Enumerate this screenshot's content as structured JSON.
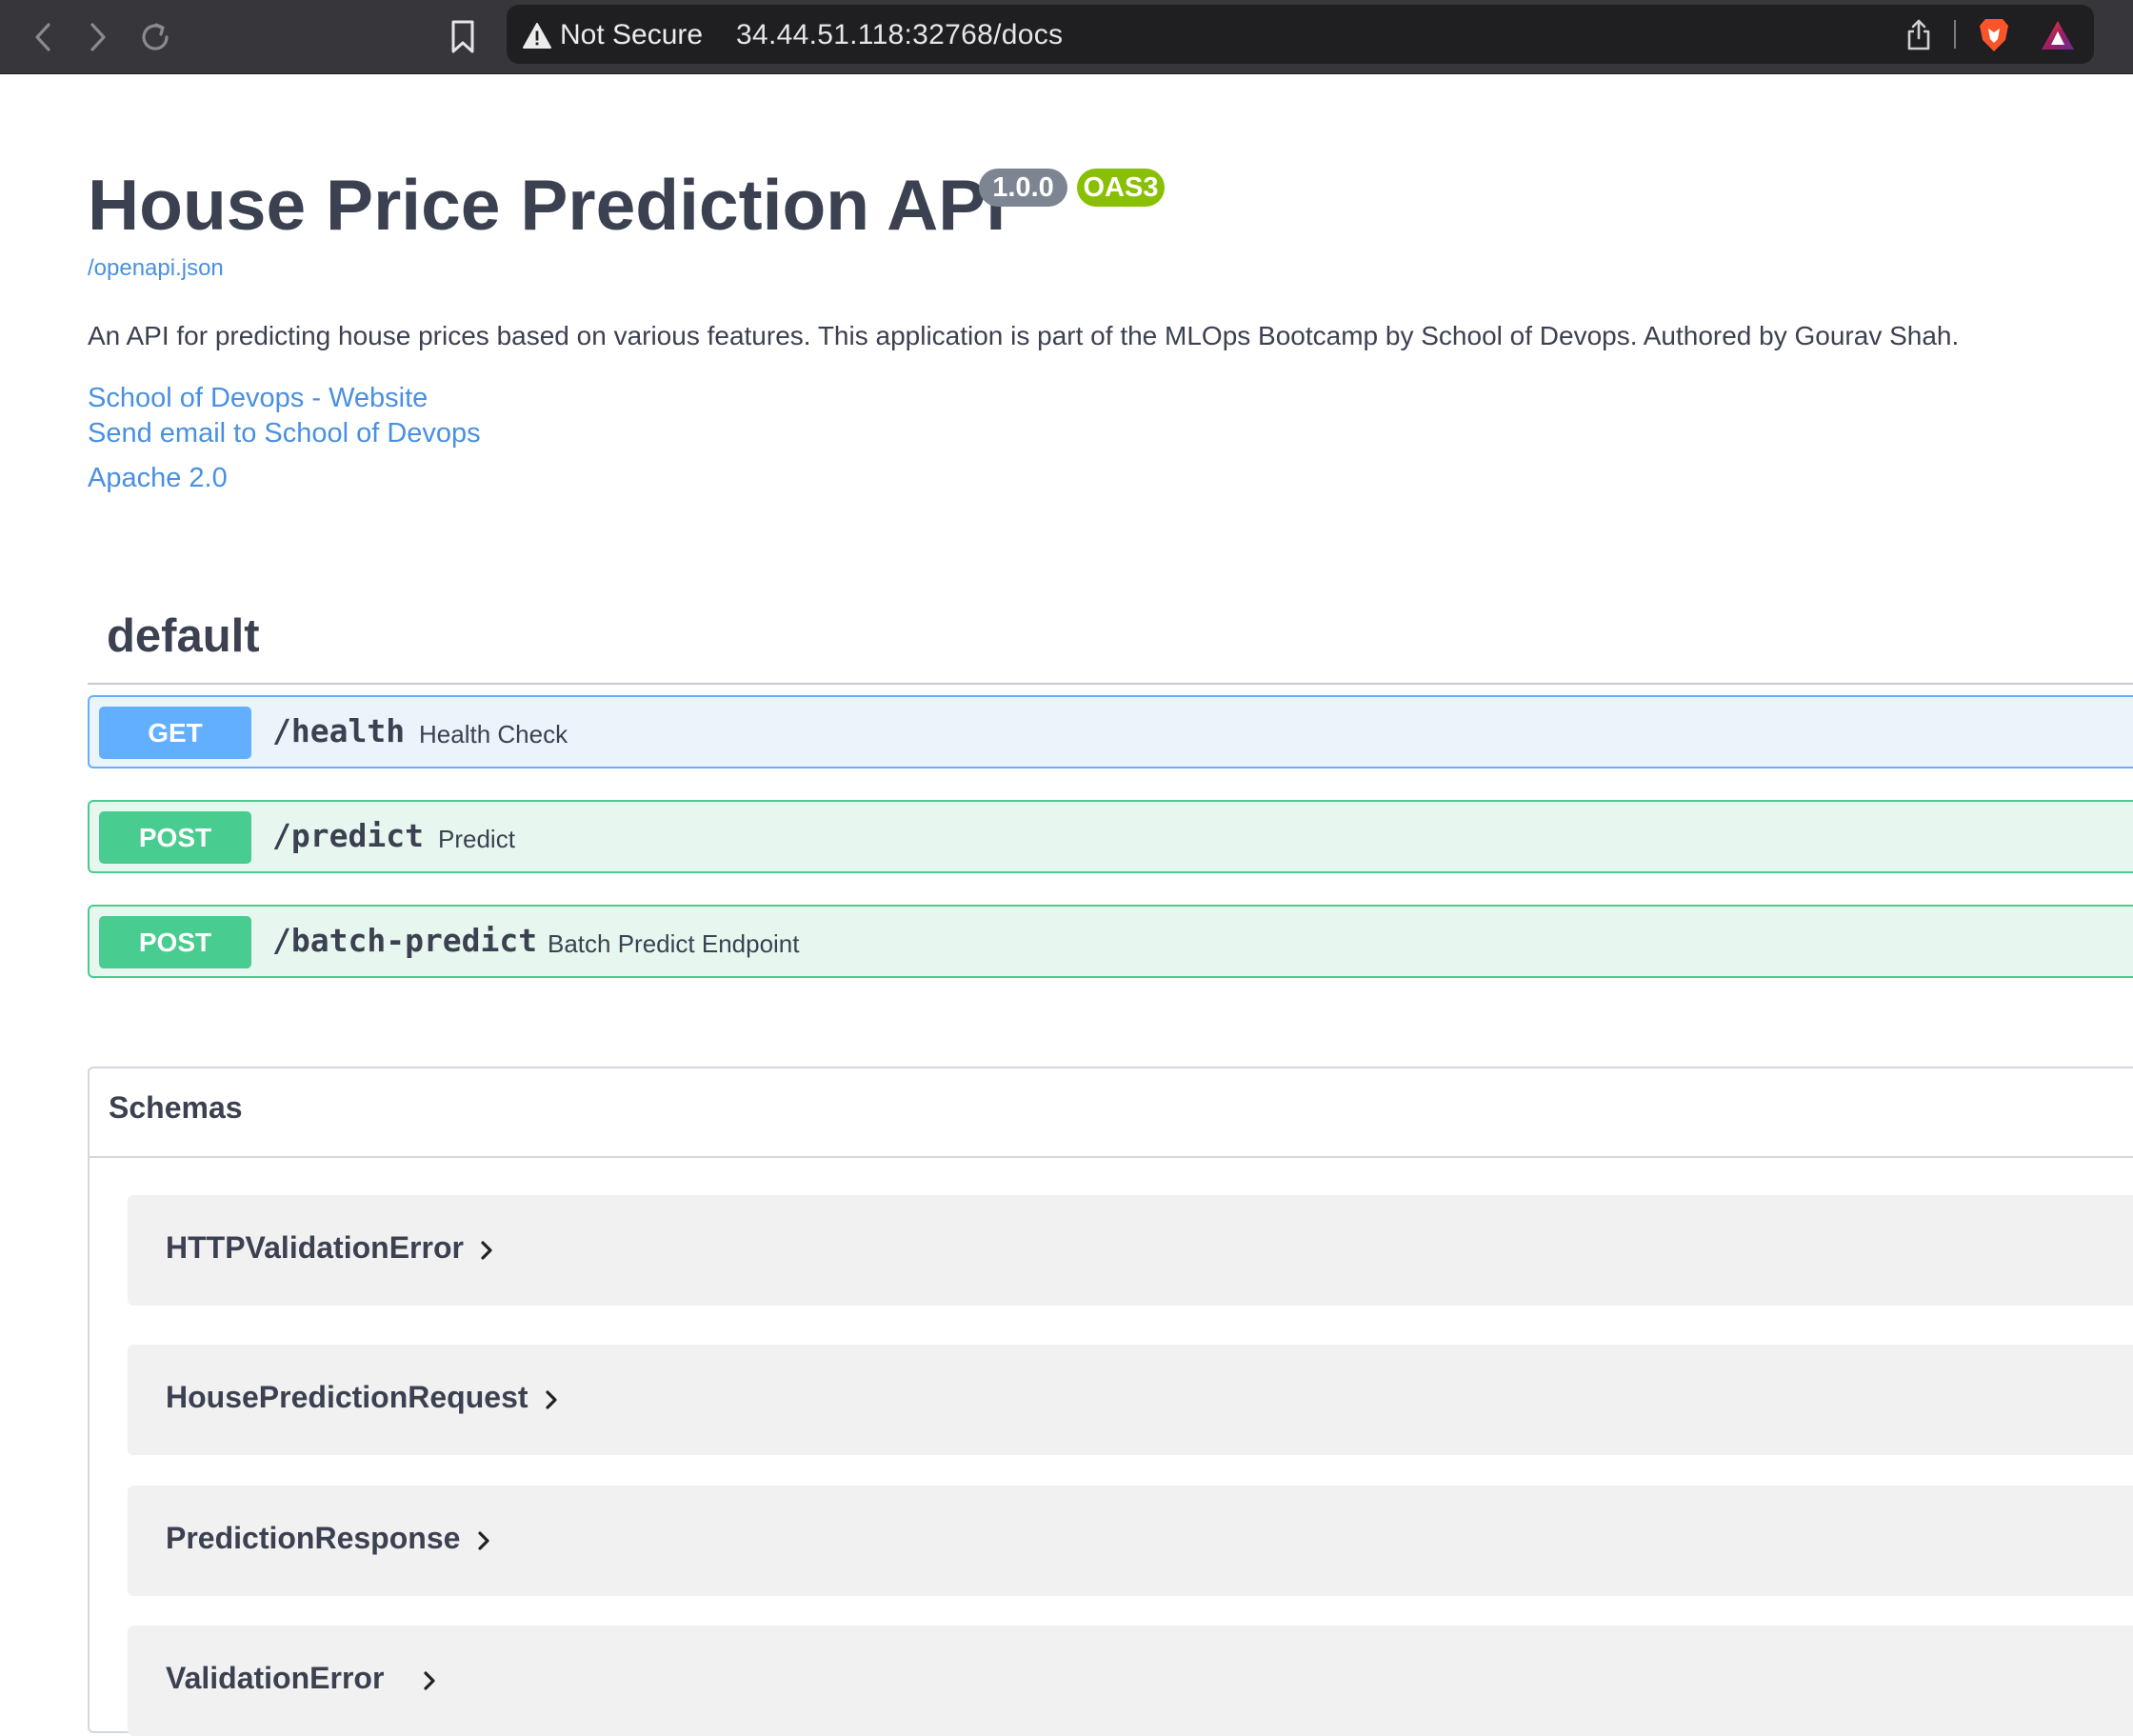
{
  "browser": {
    "security_label": "Not Secure",
    "url": "34.44.51.118:32768/docs",
    "icons": [
      "back-icon",
      "forward-icon",
      "reload-icon",
      "bookmark-icon",
      "warning-icon",
      "share-icon",
      "brave-shield-icon",
      "brave-rewards-icon"
    ]
  },
  "api": {
    "title": "House Price Prediction API",
    "version": "1.0.0",
    "oas_badge": "OAS3",
    "spec_link": "/openapi.json",
    "description": "An API for predicting house prices based on various features. This application is part of the MLOps Bootcamp by School of Devops. Authored by Gourav Shah.",
    "links": {
      "website": "School of Devops - Website",
      "email": "Send email to School of Devops",
      "license": "Apache 2.0"
    }
  },
  "colors": {
    "get": "#61affe",
    "post": "#49cc90",
    "version_badge": "#7d8492",
    "oas_badge": "#89bf04",
    "link": "#4990e2"
  },
  "section": {
    "title": "default",
    "operations": [
      {
        "method": "GET",
        "path": "/health",
        "summary": "Health Check"
      },
      {
        "method": "POST",
        "path": "/predict",
        "summary": "Predict"
      },
      {
        "method": "POST",
        "path": "/batch-predict",
        "summary": "Batch Predict Endpoint"
      }
    ]
  },
  "schemas": {
    "title": "Schemas",
    "models": [
      "HTTPValidationError",
      "HousePredictionRequest",
      "PredictionResponse",
      "ValidationError"
    ]
  }
}
